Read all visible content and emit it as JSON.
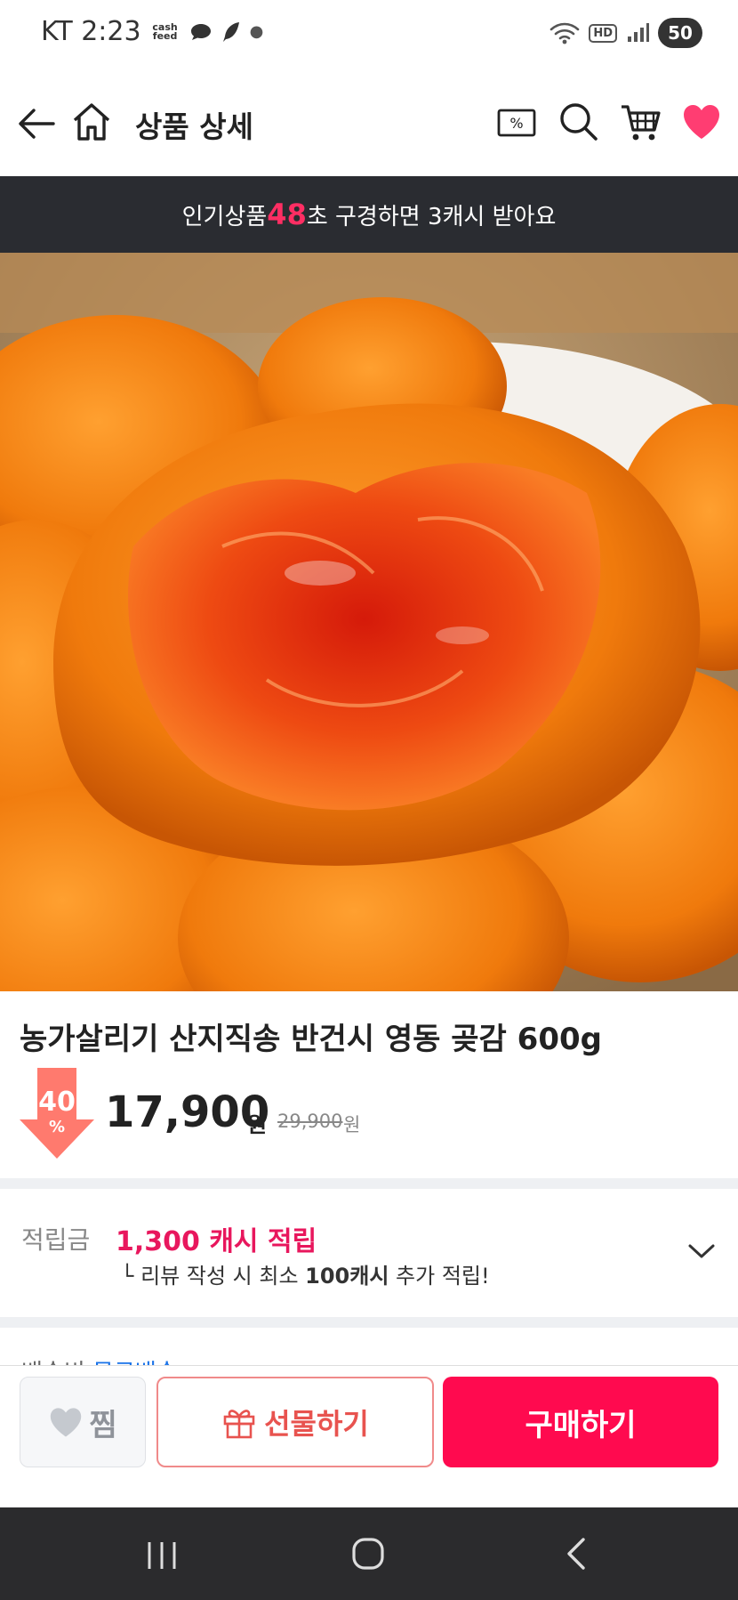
{
  "status_bar": {
    "carrier_time": "KT 2:23",
    "cashfeed_label": "cash feed",
    "battery": "50"
  },
  "header": {
    "title": "상품 상세"
  },
  "promo_banner": {
    "prefix": "인기상품 ",
    "seconds": "48",
    "suffix": "초 구경하면 3캐시 받아요"
  },
  "product": {
    "title": "농가살리기 산지직송 반건시 영동 곶감 600g",
    "discount_percent": "40",
    "discount_symbol": "%",
    "price": "17,900",
    "price_unit": "원",
    "original_price": "29,900",
    "original_unit": "원"
  },
  "reward": {
    "label": "적립금",
    "value": "1,300 캐시 적립",
    "note_prefix": "└ 리뷰 작성 시 최소 ",
    "note_bold": "100캐시",
    "note_suffix": " 추가 적립!"
  },
  "shipping_peek": {
    "label": "배송비 ",
    "value": "무료배송"
  },
  "actions": {
    "wish_label": "찜",
    "gift_label": "선물하기",
    "buy_label": "구매하기"
  },
  "colors": {
    "accent": "#ff0a4f",
    "reward": "#e8175d",
    "banner_bg": "#2a2c31"
  }
}
